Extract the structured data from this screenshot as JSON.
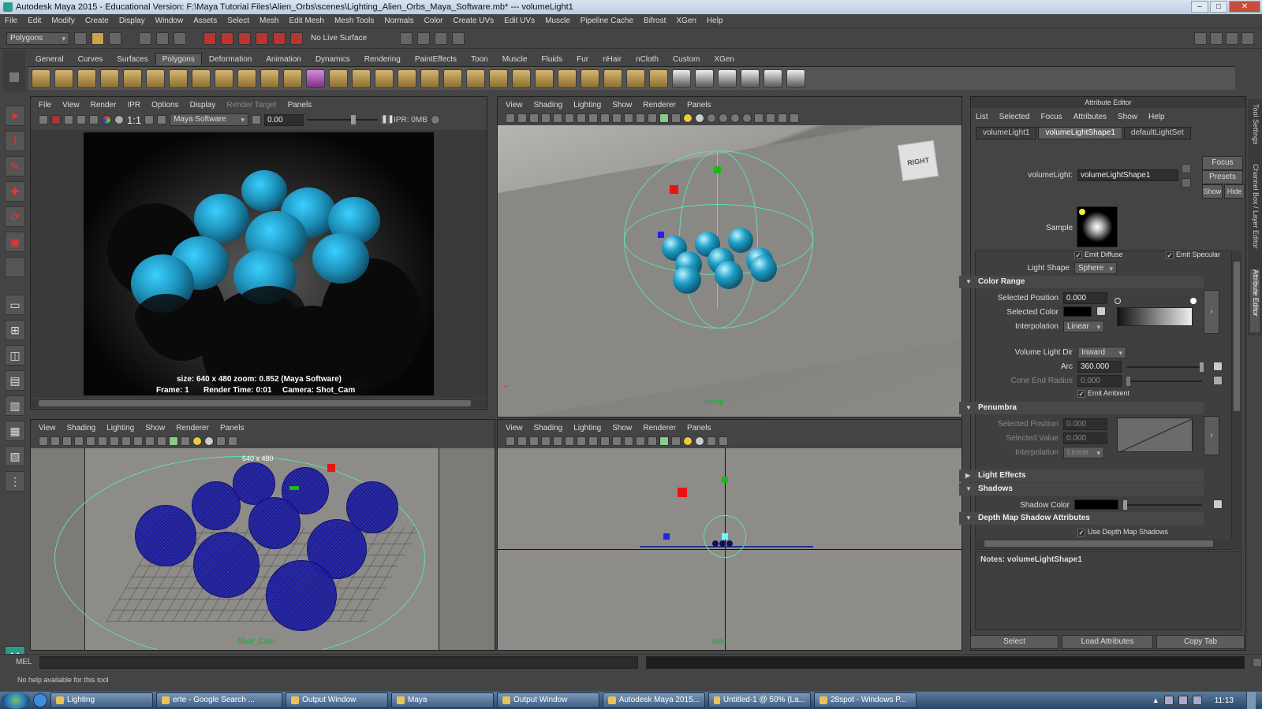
{
  "window": {
    "title": "Autodesk Maya 2015 - Educational Version: F:\\Maya Tutorial Files\\Alien_Orbs\\scenes\\Lighting_Alien_Orbs_Maya_Software.mb*  ---  volumeLight1"
  },
  "menu": [
    "File",
    "Edit",
    "Modify",
    "Create",
    "Display",
    "Window",
    "Assets",
    "Select",
    "Mesh",
    "Edit Mesh",
    "Mesh Tools",
    "Normals",
    "Color",
    "Create UVs",
    "Edit UVs",
    "Muscle",
    "Pipeline Cache",
    "Bifrost",
    "XGen",
    "Help"
  ],
  "status": {
    "menuset": "Polygons",
    "live_surface": "No Live Surface"
  },
  "shelf_tabs": [
    "General",
    "Curves",
    "Surfaces",
    "Polygons",
    "Deformation",
    "Animation",
    "Dynamics",
    "Rendering",
    "PaintEffects",
    "Toon",
    "Muscle",
    "Fluids",
    "Fur",
    "nHair",
    "nCloth",
    "Custom",
    "XGen"
  ],
  "shelf_active": "Polygons",
  "render_view": {
    "menu": [
      "File",
      "View",
      "Render",
      "IPR",
      "Options",
      "Display",
      "Render Target",
      "Panels"
    ],
    "ratio": "1:1",
    "renderer": "Maya Software",
    "exposure": "0.00",
    "ipr": "IPR: 0MB",
    "caption_line1": "size: 640 x 480  zoom: 0.852        (Maya Software)",
    "caption_frame": "Frame: 1",
    "caption_time": "Render Time: 0:01",
    "caption_camera": "Camera: Shot_Cam"
  },
  "viewport_menu": [
    "View",
    "Shading",
    "Lighting",
    "Show",
    "Renderer",
    "Panels"
  ],
  "persp": {
    "label": "persp",
    "cube_label": "RIGHT"
  },
  "shotcam": {
    "label": "Shot_Cam",
    "resolution": "640 x 480"
  },
  "side": {
    "label": "side"
  },
  "attr_editor": {
    "title": "Attribute Editor",
    "menu": [
      "List",
      "Selected",
      "Focus",
      "Attributes",
      "Show",
      "Help"
    ],
    "tabs": [
      "volumeLight1",
      "volumeLightShape1",
      "defaultLightSet"
    ],
    "active_tab": "volumeLightShape1",
    "node_label": "volumeLight:",
    "node_value": "volumeLightShape1",
    "btn_focus": "Focus",
    "btn_presets": "Presets",
    "btn_show": "Show",
    "btn_hide": "Hide",
    "sample_label": "Sample",
    "emit_diffuse": "Emit Diffuse",
    "emit_specular": "Emit Specular",
    "light_shape_label": "Light Shape",
    "light_shape_value": "Sphere",
    "color_range": {
      "section": "Color Range",
      "sel_pos_label": "Selected Position",
      "sel_pos_value": "0.000",
      "sel_color_label": "Selected Color",
      "interp_label": "Interpolation",
      "interp_value": "Linear"
    },
    "volume_dir_label": "Volume Light Dir",
    "volume_dir_value": "Inward",
    "arc_label": "Arc",
    "arc_value": "360.000",
    "cone_label": "Cone End Radius",
    "cone_value": "0.000",
    "emit_ambient": "Emit Ambient",
    "penumbra": {
      "section": "Penumbra",
      "sel_pos_label": "Selected Position",
      "sel_pos_value": "0.000",
      "sel_val_label": "Selected Value",
      "sel_val_value": "0.000",
      "interp_label": "Interpolation",
      "interp_value": "Linear"
    },
    "light_effects": "Light Effects",
    "shadows": "Shadows",
    "shadow_color_label": "Shadow Color",
    "depth_map": "Depth Map Shadow Attributes",
    "use_depth_map": "Use Depth Map Shadows",
    "notes": "Notes:  volumeLightShape1",
    "btn_select": "Select",
    "btn_load": "Load Attributes",
    "btn_copy": "Copy Tab"
  },
  "side_tabs": [
    "Tool Settings",
    "Channel Box / Layer Editor",
    "Attribute Editor"
  ],
  "mel": {
    "label": "MEL"
  },
  "help_line": "No help available for this tool",
  "taskbar": {
    "items": [
      "Lighting",
      "erte - Google Search ...",
      "Output Window",
      "Maya",
      "Output Window",
      "Autodesk Maya 2015...",
      "Untitled-1 @ 50% (La...",
      "28spot - Windows P..."
    ],
    "clock": "11:13"
  }
}
